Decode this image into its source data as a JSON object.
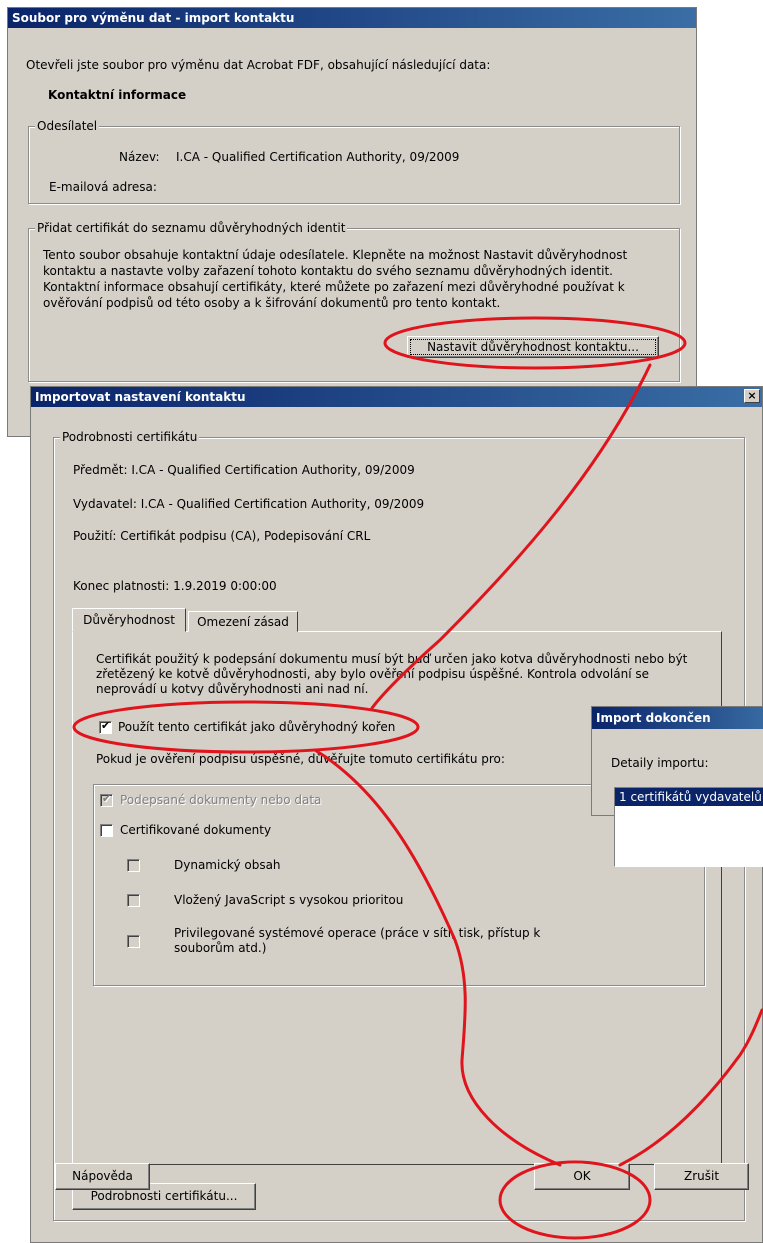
{
  "exchange_dialog": {
    "title": "Soubor pro výměnu dat - import kontaktu",
    "intro": "Otevřeli jste soubor pro výměnu dat Acrobat FDF, obsahující následující data:",
    "heading": "Kontaktní informace",
    "sender_group": "Odesílatel",
    "name_label": "Název:",
    "name_value": "I.CA - Qualified Certification Authority, 09/2009",
    "email_label": "E-mailová adresa:",
    "trust_group": "Přidat certifikát do seznamu důvěryhodných identit",
    "trust_text": "Tento soubor obsahuje kontaktní údaje odesílatele. Klepněte na možnost Nastavit důvěryhodnost kontaktu a nastavte volby zařazení tohoto kontaktu do svého seznamu důvěryhodných identit. Kontaktní informace obsahují certifikáty, které můžete po zařazení mezi důvěryhodné používat k ověřování podpisů od této osoby a k šifrování dokumentů pro tento kontakt.",
    "set_trust_button": "Nastavit důvěryhodnost kontaktu..."
  },
  "import_dialog": {
    "title": "Importovat nastavení kontaktu",
    "close_glyph": "×",
    "details_group": "Podrobnosti certifikátu",
    "subject": "Předmět:  I.CA - Qualified Certification Authority, 09/2009",
    "issuer": "Vydavatel:  I.CA - Qualified Certification Authority, 09/2009",
    "usage": "Použití:  Certifikát podpisu (CA), Podepisování CRL",
    "expiry": "Konec platnosti:  1.9.2019 0:00:00",
    "tabs": [
      "Důvěryhodnost",
      "Omezení zásad"
    ],
    "trust_paragraph": "Certifikát použitý k podepsání dokumentu musí být buď určen jako kotva důvěryhodnosti nebo být zřetězený ke kotvě důvěryhodnosti, aby bylo ověření podpisu úspěšné.  Kontrola odvolání se neprovádí u kotvy důvěryhodnosti ani nad ní.",
    "use_as_root": "Použít tento certifikát jako důvěryhodný kořen",
    "trust_for": "Pokud je ověření podpisu úspěšné, důvěřujte tomuto certifikátu pro:",
    "signed_docs": "Podepsané dokumenty nebo data",
    "certified_docs": "Certifikované dokumenty",
    "dynamic": "Dynamický obsah",
    "javascript": "Vložený JavaScript s vysokou prioritou",
    "privileged": "Privilegované systémové operace (práce v síti, tisk, přístup k souborům atd.)",
    "cert_details_button": "Podrobnosti certifikátu...",
    "help_button": "Nápověda",
    "ok_button": "OK",
    "cancel_button": "Zrušit"
  },
  "done_dialog": {
    "title": "Import dokončen",
    "label": "Detaily importu:",
    "item": "1 certifikátů vydavatelů"
  },
  "colors": {
    "annotation": "#e0141c",
    "titlebar": "#0a246a",
    "window": "#d4d0c8"
  }
}
